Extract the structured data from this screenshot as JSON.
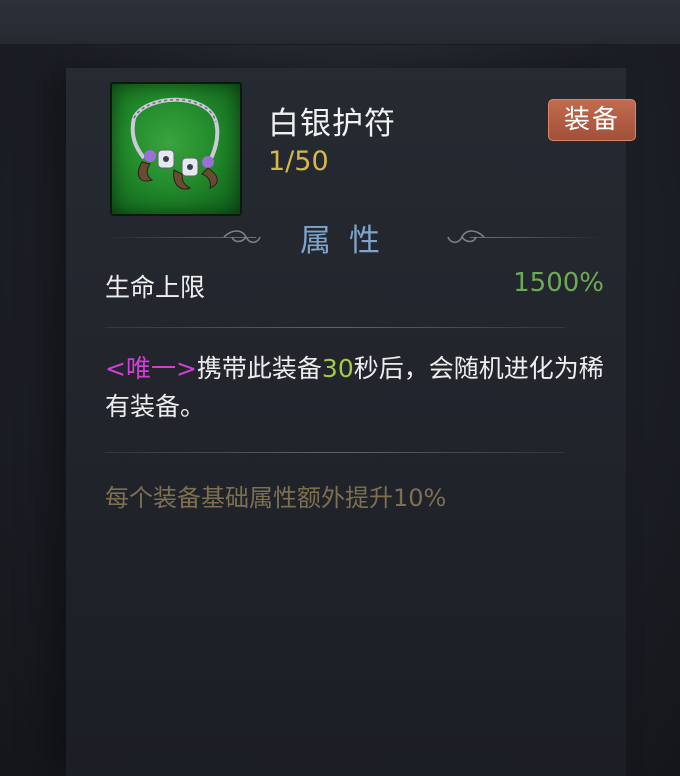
{
  "item": {
    "name": "白银护符",
    "count": "1/50",
    "type_badge": "装备",
    "icon": "silver-fang-necklace-icon",
    "rarity_color": "#228a2b"
  },
  "attributes": {
    "section_title": "属性",
    "stats": [
      {
        "label": "生命上限",
        "value": "1500%"
      }
    ]
  },
  "description": {
    "tag": "<唯一>",
    "text_before": "携带此装备",
    "highlight": "30",
    "text_after": "秒后，会随机进化为稀有装备。"
  },
  "bonus_text": "每个装备基础属性额外提升10%",
  "colors": {
    "badge": "#b45c44",
    "count": "#d4b84a",
    "section_title": "#7ea4c9",
    "stat_value": "#6cab56",
    "unique_tag": "#d03fd8",
    "highlight_number": "#a5c94a",
    "bonus": "#7d6f50"
  }
}
